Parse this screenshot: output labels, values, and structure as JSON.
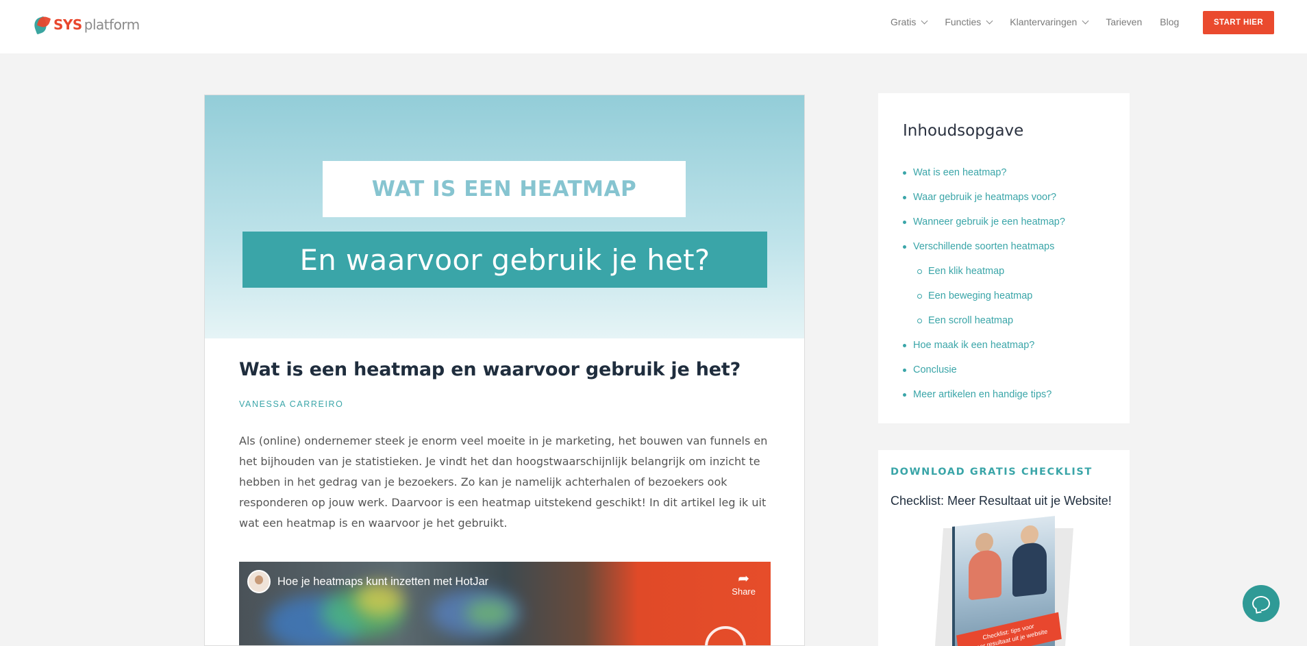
{
  "header": {
    "logo": {
      "brand": "SYS",
      "product": "platform"
    },
    "nav": [
      {
        "label": "Gratis",
        "has_dropdown": true
      },
      {
        "label": "Functies",
        "has_dropdown": true
      },
      {
        "label": "Klantervaringen",
        "has_dropdown": true
      },
      {
        "label": "Tarieven",
        "has_dropdown": false
      },
      {
        "label": "Blog",
        "has_dropdown": false
      }
    ],
    "cta_label": "START HIER"
  },
  "article": {
    "hero": {
      "line1": "WAT IS EEN HEATMAP",
      "line2": "En waarvoor gebruik je het?"
    },
    "title": "Wat is een heatmap en waarvoor gebruik je het?",
    "author": "VANESSA CARREIRO",
    "intro": "Als (online) ondernemer steek je enorm veel moeite in je marketing, het bouwen van funnels en het bijhouden van je statistieken. Je vindt het dan hoogstwaarschijnlijk belangrijk om inzicht te hebben in het gedrag van je bezoekers. Zo kan je namelijk achterhalen of bezoekers ook responderen op jouw werk. Daarvoor is een heatmap uitstekend geschikt! In dit artikel leg ik uit wat een heatmap is en waarvoor je het gebruikt.",
    "video": {
      "title": "Hoe je heatmaps kunt inzetten met HotJar",
      "share_label": "Share"
    }
  },
  "sidebar": {
    "toc": {
      "title": "Inhoudsopgave",
      "items": [
        {
          "label": "Wat is een heatmap?",
          "level": 1
        },
        {
          "label": "Waar gebruik je heatmaps voor?",
          "level": 1
        },
        {
          "label": "Wanneer gebruik je een heatmap?",
          "level": 1
        },
        {
          "label": "Verschillende soorten heatmaps",
          "level": 1
        },
        {
          "label": "Een klik heatmap",
          "level": 2
        },
        {
          "label": "Een beweging heatmap",
          "level": 2
        },
        {
          "label": "Een scroll heatmap",
          "level": 2
        },
        {
          "label": "Hoe maak ik een heatmap?",
          "level": 1
        },
        {
          "label": "Conclusie",
          "level": 1
        },
        {
          "label": "Meer artikelen en handige tips?",
          "level": 1
        }
      ]
    },
    "checklist": {
      "heading": "DOWNLOAD GRATIS CHECKLIST",
      "subtitle": "Checklist: Meer Resultaat uit je Website!",
      "book_banner_line1": "Checklist: tips voor",
      "book_banner_line2": "meer resultaat uit je website"
    }
  },
  "colors": {
    "accent": "#3aa5a8",
    "cta": "#ea4a2e",
    "hero_light": "#bfe3ea",
    "background": "#f3f3f3"
  },
  "icons": {
    "nav_dropdown": "chevron-down-icon",
    "share": "share-icon",
    "chat": "chat-icon"
  }
}
